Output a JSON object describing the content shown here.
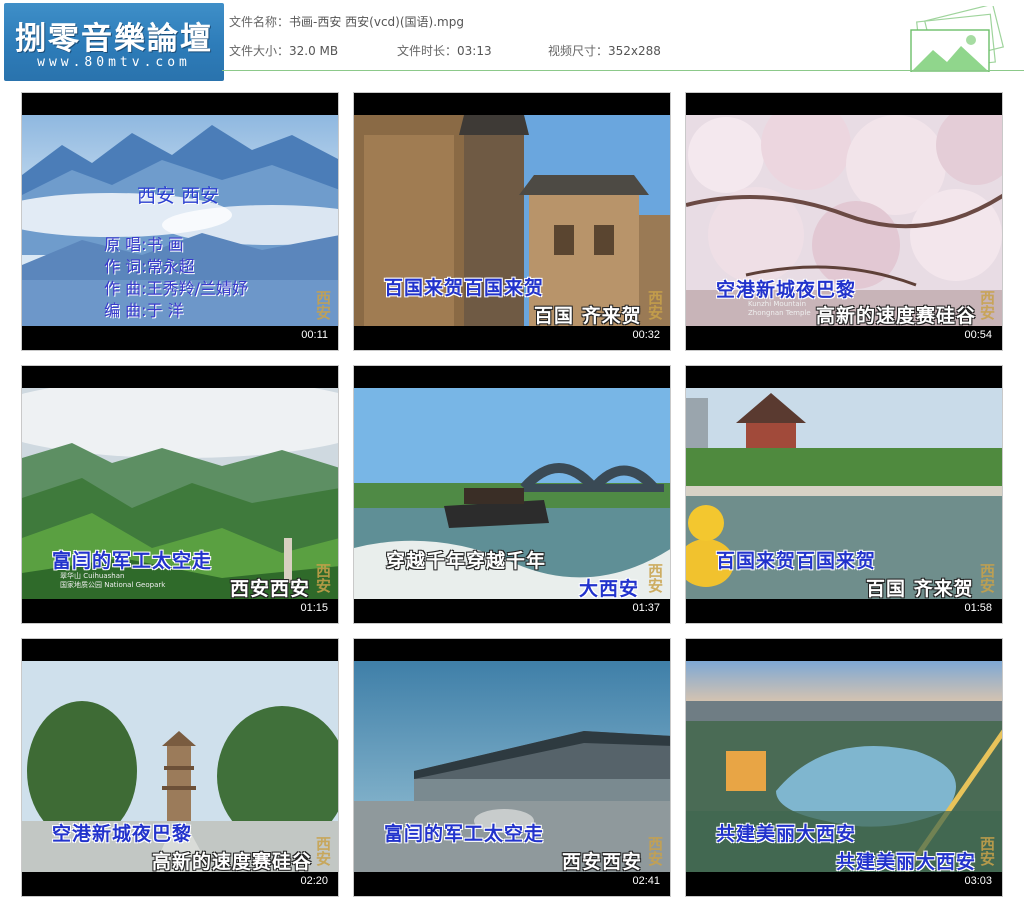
{
  "logo": {
    "title": "捌零音樂論壇",
    "url": "www.80mtv.com"
  },
  "file_info": {
    "name_label": "文件名称：",
    "name_value": "书画-西安 西安(vcd)(国语).mpg",
    "size_label": "文件大小：",
    "size_value": "32.0 MB",
    "duration_label": "文件时长：",
    "duration_value": "03:13",
    "dimensions_label": "视频尺寸：",
    "dimensions_value": "352x288"
  },
  "thumbnails": [
    {
      "timestamp": "00:11",
      "title_text": "西安 西安",
      "credits": [
        "原  唱:书  画",
        "作  词:常永超",
        "作  曲:王秀羚/兰婧妤",
        "编  曲:于  洋"
      ],
      "watermark": "西安"
    },
    {
      "timestamp": "00:32",
      "lyric_top": "百国来贺百国来贺",
      "lyric_bottom": "百国 齐来贺",
      "watermark": "西安"
    },
    {
      "timestamp": "00:54",
      "lyric_top": "空港新城夜巴黎",
      "lyric_bottom": "高新的速度赛硅谷",
      "sign_1": "Kunzhi Mountain",
      "sign_2": "Zhongnan Temple",
      "watermark": "西安"
    },
    {
      "timestamp": "01:15",
      "lyric_top": "富闫的军工太空走",
      "lyric_bottom": "西安西安",
      "sign_1": "翠华山 Cuihuashan",
      "sign_2": "国家地质公园 National Geopark",
      "watermark": "西安"
    },
    {
      "timestamp": "01:37",
      "lyric_top": "穿越千年穿越千年",
      "lyric_bottom": "大西安",
      "watermark": "西安"
    },
    {
      "timestamp": "01:58",
      "lyric_top": "百国来贺百国来贺",
      "lyric_bottom": "百国 齐来贺",
      "watermark": "西安"
    },
    {
      "timestamp": "02:20",
      "lyric_top": "空港新城夜巴黎",
      "lyric_bottom": "高新的速度赛硅谷",
      "watermark": "西安"
    },
    {
      "timestamp": "02:41",
      "lyric_top": "富闫的军工太空走",
      "lyric_bottom": "西安西安",
      "watermark": "西安"
    },
    {
      "timestamp": "03:03",
      "lyric_top": "共建美丽大西安",
      "lyric_bottom": "共建美丽大西安",
      "watermark": "西安"
    }
  ],
  "colors": {
    "header_line": "#8cc98a",
    "logo_bg": "#2d7cb9",
    "lyric_blue": "#2233cc"
  },
  "icons": {
    "header_decoration": "picture-stack-icon"
  }
}
